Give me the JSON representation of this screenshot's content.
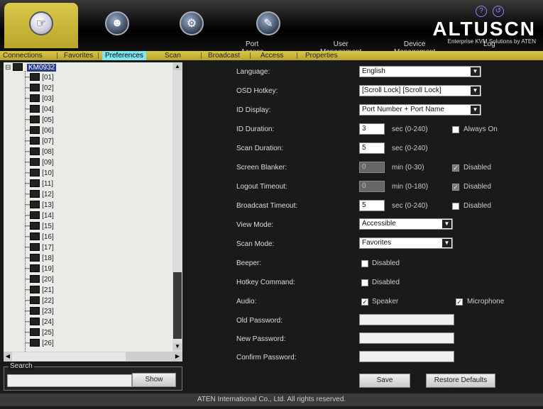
{
  "header": {
    "nav": [
      {
        "label": "Port Access",
        "icon": "port-access-icon",
        "active": true
      },
      {
        "label": "User Management",
        "icon": "user-management-icon",
        "active": false
      },
      {
        "label": "Device Management",
        "icon": "device-management-icon",
        "active": false
      },
      {
        "label": "Log",
        "icon": "log-icon",
        "active": false
      }
    ],
    "brand_name": "ALTUSCN",
    "brand_tag": "Enterprise KVM Solutions by ATEN"
  },
  "submenu": [
    "Connections",
    "Favorites",
    "Preferences",
    "Scan",
    "Broadcast",
    "Access",
    "Properties"
  ],
  "submenu_active": "Preferences",
  "tree": {
    "root": "KM0932",
    "ports": [
      "[01]",
      "[02]",
      "[03]",
      "[04]",
      "[05]",
      "[06]",
      "[07]",
      "[08]",
      "[09]",
      "[10]",
      "[11]",
      "[12]",
      "[13]",
      "[14]",
      "[15]",
      "[16]",
      "[17]",
      "[18]",
      "[19]",
      "[20]",
      "[21]",
      "[22]",
      "[23]",
      "[24]",
      "[25]",
      "[26]"
    ]
  },
  "search": {
    "label": "Search",
    "value": "",
    "show_button": "Show"
  },
  "form": {
    "language": {
      "label": "Language:",
      "value": "English"
    },
    "osd_hotkey": {
      "label": "OSD Hotkey:",
      "value": "[Scroll Lock] [Scroll Lock]"
    },
    "id_display": {
      "label": "ID Display:",
      "value": "Port Number + Port Name"
    },
    "id_duration": {
      "label": "ID Duration:",
      "value": "3",
      "unit": "sec (0-240)",
      "check_label": "Always On",
      "checked": false
    },
    "scan_duration": {
      "label": "Scan Duration:",
      "value": "5",
      "unit": "sec (0-240)"
    },
    "screen_blanker": {
      "label": "Screen Blanker:",
      "value": "0",
      "unit": "min (0-30)",
      "check_label": "Disabled",
      "checked": true
    },
    "logout_timeout": {
      "label": "Logout Timeout:",
      "value": "0",
      "unit": "min (0-180)",
      "check_label": "Disabled",
      "checked": true
    },
    "broadcast_timeout": {
      "label": "Broadcast Timeout:",
      "value": "5",
      "unit": "sec (0-240)",
      "check_label": "Disabled",
      "checked": false
    },
    "view_mode": {
      "label": "View Mode:",
      "value": "Accessible"
    },
    "scan_mode": {
      "label": "Scan Mode:",
      "value": "Favorites"
    },
    "beeper": {
      "label": "Beeper:",
      "check_label": "Disabled",
      "checked": false
    },
    "hotkey_command": {
      "label": "Hotkey Command:",
      "check_label": "Disabled",
      "checked": false
    },
    "audio": {
      "label": "Audio:",
      "speaker_label": "Speaker",
      "speaker_checked": true,
      "mic_label": "Microphone",
      "mic_checked": true
    },
    "old_password": {
      "label": "Old Password:",
      "value": ""
    },
    "new_password": {
      "label": "New Password:",
      "value": ""
    },
    "confirm_password": {
      "label": "Confirm Password:",
      "value": ""
    }
  },
  "buttons": {
    "save": "Save",
    "restore": "Restore Defaults"
  },
  "footer": "ATEN International Co., Ltd. All rights reserved."
}
